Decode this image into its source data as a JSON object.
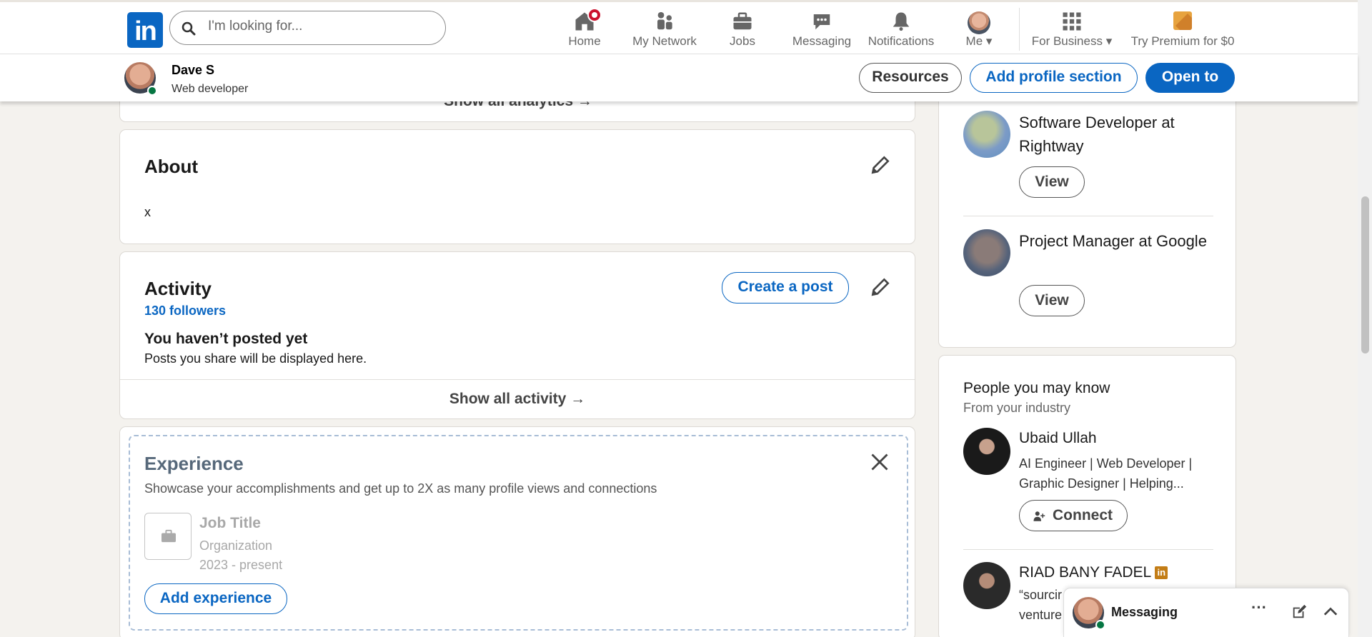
{
  "nav": {
    "search_placeholder": "I'm looking for...",
    "home": "Home",
    "network": "My Network",
    "jobs": "Jobs",
    "messaging": "Messaging",
    "notifications": "Notifications",
    "me": "Me",
    "for_business": "For Business",
    "premium": "Try Premium for $0"
  },
  "profile_bar": {
    "name": "Dave S",
    "title": "Web developer",
    "resources": "Resources",
    "add_section": "Add profile section",
    "open_to": "Open to"
  },
  "analytics": {
    "show_all": "Show all analytics →"
  },
  "about": {
    "heading": "About",
    "text": "x"
  },
  "activity": {
    "heading": "Activity",
    "followers": "130 followers",
    "create_post": "Create a post",
    "empty_title": "You haven’t posted yet",
    "empty_sub": "Posts you share will be displayed here.",
    "show_all": "Show all activity →"
  },
  "experience": {
    "heading": "Experience",
    "subtitle": "Showcase your accomplishments and get up to 2X as many profile views and connections",
    "job_title": "Job Title",
    "organization": "Organization",
    "dates": "2023 - present",
    "add_button": "Add experience"
  },
  "suggested_jobs": [
    {
      "title": "Software Developer at Rightway",
      "button": "View"
    },
    {
      "title": "Project Manager at Google",
      "button": "View"
    }
  ],
  "people": {
    "heading": "People you may know",
    "subheading": "From your industry",
    "items": [
      {
        "name": "Ubaid Ullah",
        "headline": "AI Engineer | Web Developer | Graphic Designer | Helping...",
        "button": "Connect"
      },
      {
        "name": "RIAD BANY FADEL",
        "headline_partial_1": "“sourcir",
        "headline_partial_2": "venture"
      }
    ]
  },
  "messaging_bar": {
    "label": "Messaging"
  }
}
